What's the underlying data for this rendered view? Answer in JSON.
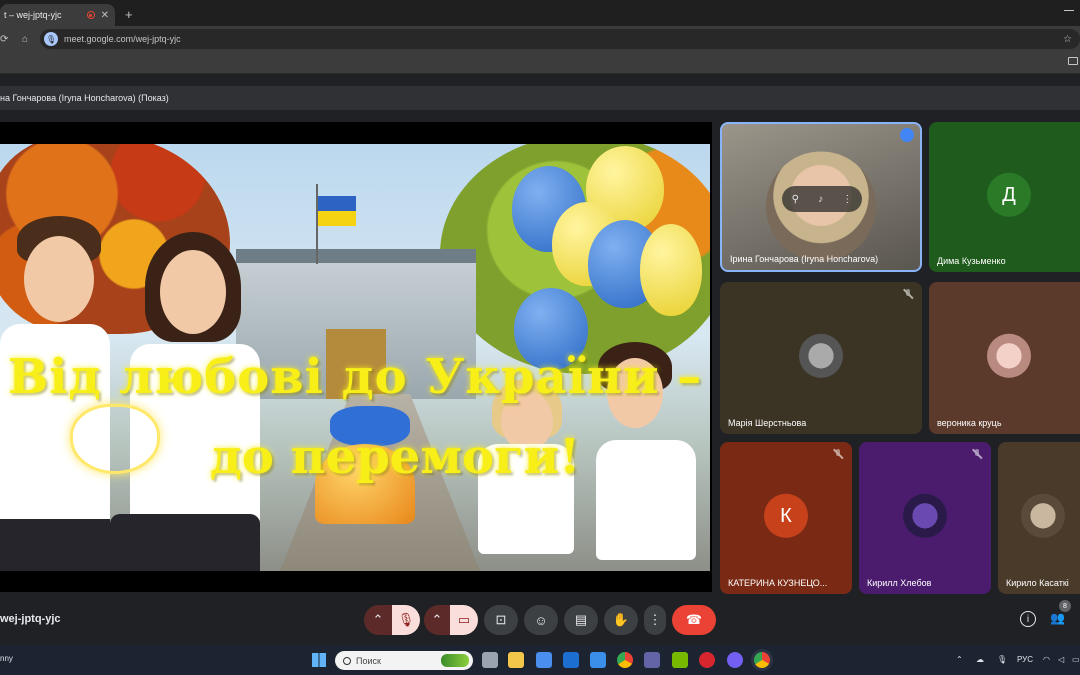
{
  "browser": {
    "tab_title": "t – wej-jptq-yjc",
    "tab_close": "✕",
    "new_tab": "+",
    "url": "meet.google.com/wej-jptq-yjc"
  },
  "meet": {
    "presenting_banner": "на Гончарова (Iryna Honcharova) (Показ)",
    "meeting_code": "wej-jptq-yjc",
    "participant_count": "8",
    "slide": {
      "line1": "Від любові до України –",
      "line2": "до перемоги!"
    },
    "tiles": [
      {
        "name": "Ірина Гончарова (Iryna Honcharova)",
        "initial": "",
        "bg": "#6d6b66",
        "speaking": true
      },
      {
        "name": "Дима Кузьменко",
        "initial": "Д",
        "bg": "#1e5b1c",
        "avatar_bg": "#2a7a28"
      },
      {
        "name": "Марія Шерстньова",
        "initial": "",
        "bg": "#3b3424"
      },
      {
        "name": "вероника круць",
        "initial": "",
        "bg": "#5b3a2c"
      },
      {
        "name": "КАТЕРИНА КУЗНЕЦО...",
        "initial": "К",
        "bg": "#7a2a14",
        "avatar_bg": "#c7421b"
      },
      {
        "name": "Кирилл Хлебов",
        "initial": "",
        "bg": "#4b1c6e"
      },
      {
        "name": "Кирило Касаткі",
        "initial": "",
        "bg": "#4a3a2a"
      }
    ]
  },
  "taskbar": {
    "weather": "nny",
    "search_placeholder": "Поиск",
    "lang": "РУС"
  },
  "colors": {
    "end_call": "#ea4335",
    "slide_text": "#f8ef18",
    "active_tile_border": "#8ab4f8"
  }
}
